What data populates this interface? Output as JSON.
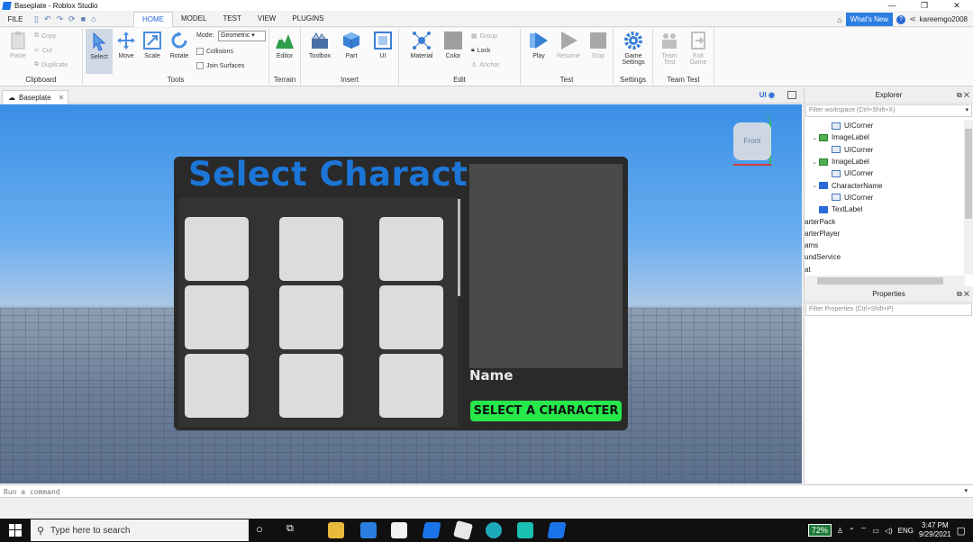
{
  "window": {
    "title": "Baseplate - Roblox Studio",
    "controls": [
      "—",
      "❐",
      "✕"
    ]
  },
  "menu": {
    "file": "FILE",
    "tabs": [
      "HOME",
      "MODEL",
      "TEST",
      "VIEW",
      "PLUGINS"
    ],
    "active_tab": "HOME",
    "whats_new": "What's New",
    "help": "?",
    "username": "kareemgo2008"
  },
  "ribbon": {
    "clipboard": {
      "label": "Clipboard",
      "paste": "Paste",
      "copy": "Copy",
      "cut": "Cut",
      "duplicate": "Duplicate"
    },
    "tools": {
      "label": "Tools",
      "select": "Select",
      "move": "Move",
      "scale": "Scale",
      "rotate": "Rotate",
      "mode_label": "Mode:",
      "mode_value": "Geometric",
      "collisions": "Collisions",
      "join_surfaces": "Join Surfaces"
    },
    "terrain": {
      "label": "Terrain",
      "editor": "Editor"
    },
    "insert": {
      "label": "Insert",
      "toolbox": "Toolbox",
      "part": "Part",
      "ui": "UI"
    },
    "edit": {
      "label": "Edit",
      "material": "Material",
      "color": "Color",
      "group": "Group",
      "lock": "Lock",
      "anchor": "Anchor"
    },
    "test": {
      "label": "Test",
      "play": "Play",
      "resume": "Resume",
      "stop": "Stop"
    },
    "settings": {
      "label": "Settings",
      "game_settings_1": "Game",
      "game_settings_2": "Settings"
    },
    "team_test": {
      "label": "Team Test",
      "team_1": "Team",
      "team_2": "Test",
      "exit_1": "Exit",
      "exit_2": "Game"
    }
  },
  "doc_tab": {
    "label": "Baseplate",
    "close": "✕",
    "ui_toggle": "UI"
  },
  "viewport": {
    "viewcube_label": "Front",
    "axis_label": "Y"
  },
  "gui": {
    "title": "Select Character",
    "name_label": "Name",
    "select_button": "SELECT A CHARACTER"
  },
  "explorer": {
    "title": "Explorer",
    "filter_placeholder": "Filter workspace (Ctrl+Shift+X)",
    "rows": [
      {
        "label": "UICorner",
        "indent": 2,
        "icon": "ui"
      },
      {
        "label": "ImageLabel",
        "indent": 1,
        "icon": "img",
        "arrow": "⌄"
      },
      {
        "label": "UICorner",
        "indent": 2,
        "icon": "ui"
      },
      {
        "label": "ImageLabel",
        "indent": 1,
        "icon": "img",
        "arrow": "⌄"
      },
      {
        "label": "UICorner",
        "indent": 2,
        "icon": "ui"
      },
      {
        "label": "CharacterName",
        "indent": 1,
        "icon": "txt",
        "arrow": "⌄"
      },
      {
        "label": "UICorner",
        "indent": 2,
        "icon": "ui"
      },
      {
        "label": "TextLabel",
        "indent": 1,
        "icon": "txt"
      },
      {
        "label": "arterPack",
        "indent": 0
      },
      {
        "label": "arterPlayer",
        "indent": 0
      },
      {
        "label": "ams",
        "indent": 0
      },
      {
        "label": "undService",
        "indent": 0
      },
      {
        "label": "at",
        "indent": 0
      }
    ]
  },
  "properties": {
    "title": "Properties",
    "filter_placeholder": "Filter Properties (Ctrl+Shift+P)"
  },
  "command_bar": {
    "placeholder": "Run a command"
  },
  "taskbar": {
    "search_placeholder": "Type here to search",
    "battery": "72%",
    "language": "ENG",
    "time": "3:47 PM",
    "date": "9/29/2021"
  },
  "colors": {
    "accent": "#2a6ad8",
    "gui_title": "#1b76d8",
    "select_button": "#26e84a",
    "slot": "#dcdcdc"
  }
}
